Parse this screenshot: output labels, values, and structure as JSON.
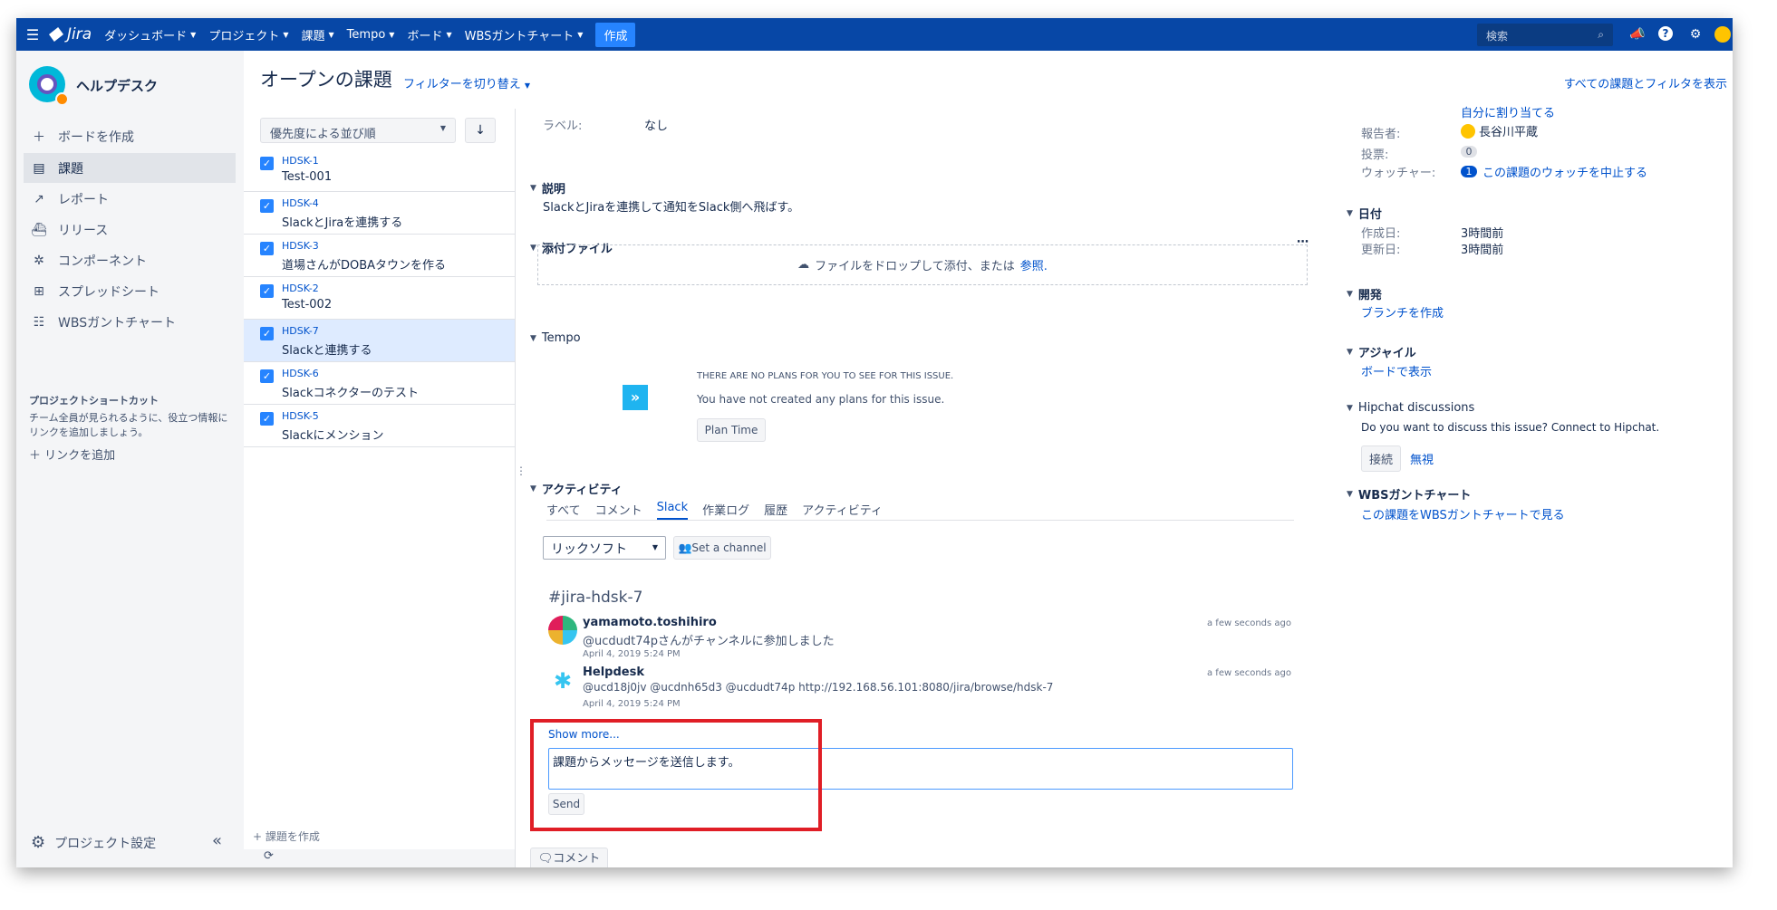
{
  "nav": {
    "app_name": "Jira",
    "items": [
      {
        "label": "ダッシュボード"
      },
      {
        "label": "プロジェクト"
      },
      {
        "label": "課題"
      },
      {
        "label": "Tempo"
      },
      {
        "label": "ボード"
      },
      {
        "label": "WBSガントチャート"
      }
    ],
    "create_label": "作成",
    "search_placeholder": "検索"
  },
  "sidebar": {
    "project_name": "ヘルプデスク",
    "items": [
      {
        "label": "ボードを作成",
        "icon": "plus-icon"
      },
      {
        "label": "課題",
        "icon": "issues-icon",
        "active": true
      },
      {
        "label": "レポート",
        "icon": "chart-icon"
      },
      {
        "label": "リリース",
        "icon": "ship-icon"
      },
      {
        "label": "コンポーネント",
        "icon": "puzzle-icon"
      },
      {
        "label": "スプレッドシート",
        "icon": "table-icon"
      },
      {
        "label": "WBSガントチャート",
        "icon": "gantt-icon"
      }
    ],
    "shortcut_title": "プロジェクトショートカット",
    "shortcut_desc": "チーム全員が見られるように、役立つ情報にリンクを追加しましょう。",
    "add_link": "リンクを追加",
    "settings_label": "プロジェクト設定"
  },
  "header": {
    "title": "オープンの課題",
    "filter_switch": "フィルターを切り替え",
    "all_filters": "すべての課題とフィルタを表示"
  },
  "issue_list": {
    "sort_label": "優先度による並び順",
    "issues": [
      {
        "key": "HDSK-1",
        "summary": "Test-001"
      },
      {
        "key": "HDSK-4",
        "summary": "SlackとJiraを連携する"
      },
      {
        "key": "HDSK-3",
        "summary": "道場さんがDOBAタウンを作る"
      },
      {
        "key": "HDSK-2",
        "summary": "Test-002"
      },
      {
        "key": "HDSK-7",
        "summary": "Slackと連携する",
        "selected": true
      },
      {
        "key": "HDSK-6",
        "summary": "Slackコネクターのテスト"
      },
      {
        "key": "HDSK-5",
        "summary": "Slackにメンション"
      }
    ],
    "create_issue": "+ 課題を作成"
  },
  "detail": {
    "label_field": "ラベル:",
    "label_value": "なし",
    "description_title": "説明",
    "description_text": "SlackとJiraを連携して通知をSlack側へ飛ばす。",
    "attachments_title": "添付ファイル",
    "dropzone_text": "ファイルをドロップして添付、または",
    "dropzone_link": "参照.",
    "tempo_title": "Tempo",
    "tempo_heading": "THERE ARE NO PLANS FOR YOU TO SEE FOR THIS ISSUE.",
    "tempo_text": "You have not created any plans for this issue.",
    "plan_time": "Plan Time",
    "activity_title": "アクティビティ",
    "tabs": [
      "すべて",
      "コメント",
      "Slack",
      "作業ログ",
      "履歴",
      "アクティビティ"
    ],
    "workspace": "リックソフト",
    "set_channel": "Set a channel",
    "channel": "#jira-hdsk-7",
    "messages": [
      {
        "user": "yamamoto.toshihiro",
        "text": "@ucdudt74pさんがチャンネルに参加しました",
        "time": "April 4, 2019 5:24 PM",
        "ago": "a few seconds ago"
      },
      {
        "user": "Helpdesk",
        "text": "@ucd18j0jv @ucdnh65d3 @ucdudt74p http://192.168.56.101:8080/jira/browse/hdsk-7",
        "time": "April 4, 2019 5:24 PM",
        "ago": "a few seconds ago"
      }
    ],
    "show_more": "Show more...",
    "message_input": "課題からメッセージを送信します。",
    "send": "Send",
    "comment_button": "コメント"
  },
  "right_panel": {
    "assign_to_me": "自分に割り当てる",
    "reporter_label": "報告者:",
    "reporter": "長谷川平蔵",
    "votes_label": "投票:",
    "votes": "0",
    "watchers_label": "ウォッチャー:",
    "watchers": "1",
    "stop_watching": "この課題のウォッチを中止する",
    "dates_title": "日付",
    "created_label": "作成日:",
    "created": "3時間前",
    "updated_label": "更新日:",
    "updated": "3時間前",
    "dev_title": "開発",
    "create_branch": "ブランチを作成",
    "agile_title": "アジャイル",
    "view_board": "ボードで表示",
    "hipchat_title": "Hipchat discussions",
    "hipchat_text": "Do you want to discuss this issue? Connect to Hipchat.",
    "connect": "接続",
    "ignore": "無視",
    "wbs_title": "WBSガントチャート",
    "wbs_link": "この課題をWBSガントチャートで見る"
  }
}
